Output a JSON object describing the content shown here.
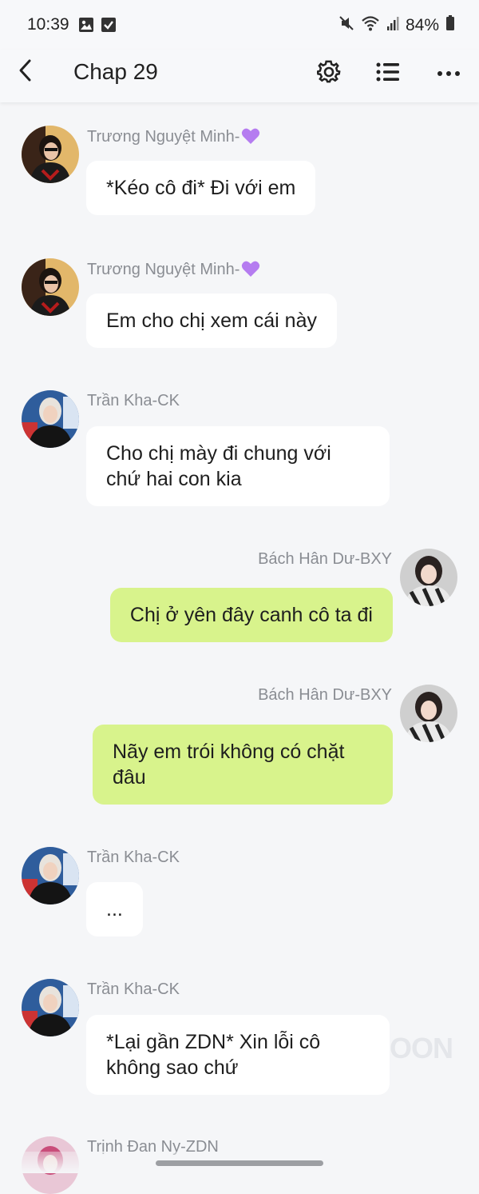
{
  "status_bar": {
    "time": "10:39",
    "battery": "84%",
    "icons_left": [
      "gallery-icon",
      "checkbox-icon"
    ],
    "icons_right": [
      "mute-icon",
      "wifi-icon",
      "signal-icon",
      "battery-icon"
    ]
  },
  "app_bar": {
    "title": "Chap 29",
    "icons": [
      "back-arrow-icon",
      "gear-icon",
      "list-icon",
      "more-icon"
    ]
  },
  "messages": [
    {
      "side": "left",
      "name": "Trương Nguyệt Minh-",
      "name_emoji": "purple-heart",
      "text": "*Kéo cô đi* Đi với em"
    },
    {
      "side": "left",
      "name": "Trương Nguyệt Minh-",
      "name_emoji": "purple-heart",
      "text": "Em cho chị xem cái này"
    },
    {
      "side": "left",
      "name": "Trần Kha-CK",
      "text": "Cho chị mày đi chung với\nchứ hai con kia"
    },
    {
      "side": "right",
      "name": "Bách Hân Dư-BXY",
      "text": "Chị ở yên đây canh cô ta đi"
    },
    {
      "side": "right",
      "name": "Bách Hân Dư-BXY",
      "text": "Nãy em trói không có chặt\nđâu"
    },
    {
      "side": "left",
      "name": "Trần Kha-CK",
      "text": "..."
    },
    {
      "side": "left",
      "name": "Trần Kha-CK",
      "text": "*Lại gần ZDN* Xin lỗi cô\nkhông sao chứ"
    },
    {
      "side": "left",
      "name": "Trịnh Đan Ny-ZDN",
      "text": ""
    }
  ],
  "watermark": "OON",
  "colors": {
    "background": "#f5f6f8",
    "bubble_left": "#ffffff",
    "bubble_right": "#d8f38c",
    "name_text": "#8a8d93",
    "heart": "#b57cf0"
  }
}
